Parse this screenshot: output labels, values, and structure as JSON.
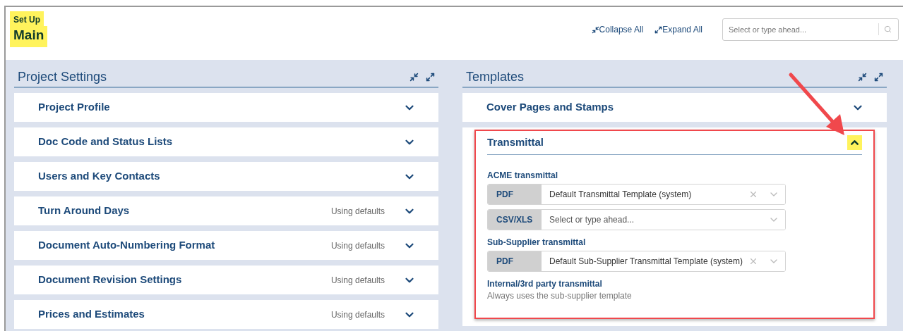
{
  "header": {
    "breadcrumb": "Set Up",
    "title": "Main",
    "collapse_all": "Collapse All",
    "expand_all": "Expand All",
    "search": {
      "placeholder": "Select or type ahead..."
    }
  },
  "panels": [
    {
      "title": "Project Settings",
      "items": [
        {
          "title": "Project Profile",
          "expanded": false
        },
        {
          "title": "Doc Code and Status Lists",
          "expanded": false
        },
        {
          "title": "Users and Key Contacts",
          "expanded": false
        },
        {
          "title": "Turn Around Days",
          "note": "Using defaults",
          "expanded": false
        },
        {
          "title": "Document Auto-Numbering Format",
          "note": "Using defaults",
          "expanded": false
        },
        {
          "title": "Document Revision Settings",
          "note": "Using defaults",
          "expanded": false
        },
        {
          "title": "Prices and Estimates",
          "note": "Using defaults",
          "expanded": false
        }
      ]
    },
    {
      "title": "Templates",
      "items": [
        {
          "title": "Cover Pages and Stamps",
          "expanded": false
        },
        {
          "title": "Transmittal",
          "expanded": true,
          "sections": [
            {
              "label": "ACME transmittal",
              "selects": [
                {
                  "format": "PDF",
                  "value": "Default Transmittal Template (system)"
                },
                {
                  "format": "CSV/XLS",
                  "placeholder": "Select or type ahead..."
                }
              ]
            },
            {
              "label": "Sub-Supplier transmittal",
              "selects": [
                {
                  "format": "PDF",
                  "value": "Default Sub-Supplier Transmittal Template (system)"
                }
              ]
            },
            {
              "label": "Internal/3rd party transmittal",
              "note": "Always uses the sub-supplier template"
            }
          ]
        }
      ]
    }
  ]
}
